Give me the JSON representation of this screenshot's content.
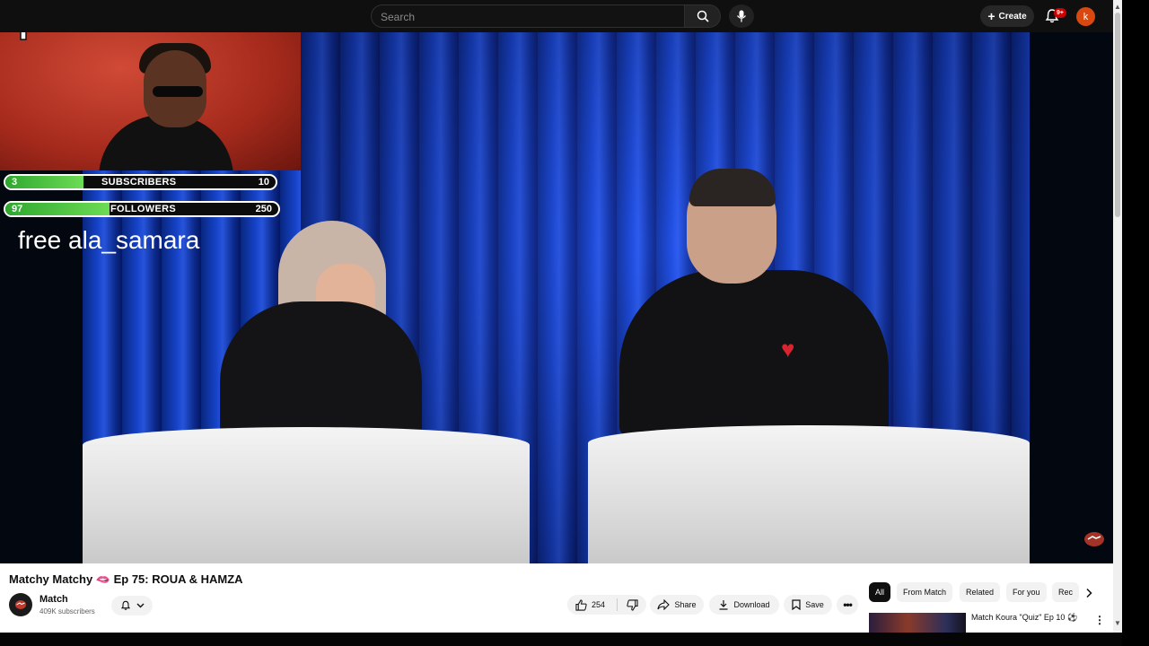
{
  "search": {
    "placeholder": "Search"
  },
  "header": {
    "create_label": "Create",
    "notification_badge": "9+",
    "account_initial": "k"
  },
  "overlay": {
    "subscribers": {
      "current": "3",
      "label": "SUBSCRIBERS",
      "goal": "10",
      "progress": 0.3
    },
    "followers": {
      "current": "97",
      "label": "FOLLOWERS",
      "goal": "250",
      "progress": 0.39
    },
    "free_text": "free ala_samara"
  },
  "video": {
    "title": "Matchy Matchy 🫦 Ep 75: ROUA & HAMZA",
    "channel_name": "Match",
    "channel_subscribers": "409K subscribers",
    "like_count": "254",
    "share_label": "Share",
    "download_label": "Download",
    "save_label": "Save"
  },
  "chips": [
    "All",
    "From Match",
    "Related",
    "For you",
    "Rec"
  ],
  "recommendation": {
    "title": "Match Koura \"Quiz\" Ep 10 ⚽",
    "subtitle": ""
  },
  "colors": {
    "accent_red": "#cc0000",
    "avatar_orange": "#d9480f",
    "progress_green": "#4cc63f"
  }
}
